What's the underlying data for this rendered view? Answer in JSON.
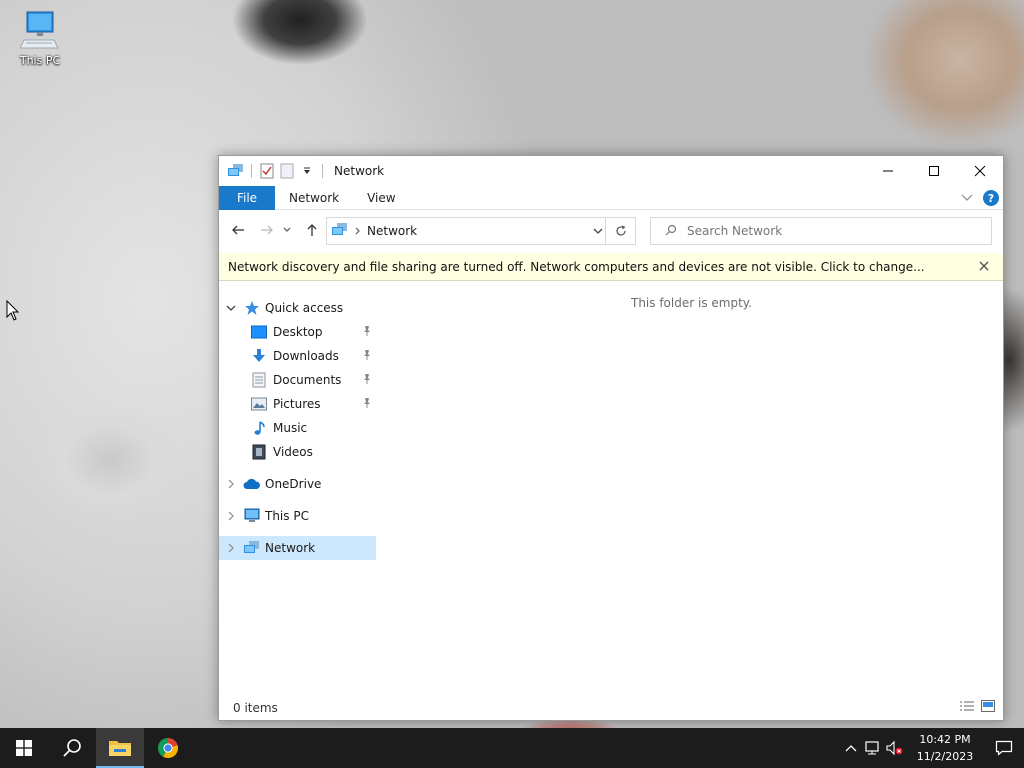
{
  "desktop": {
    "icons": [
      {
        "label": "This PC",
        "icon": "this-pc-icon"
      }
    ]
  },
  "window": {
    "title": "Network",
    "controls": {
      "minimize": "minimize-icon",
      "maximize": "maximize-icon",
      "close": "close-icon"
    }
  },
  "ribbon": {
    "tabs": [
      "File",
      "Network",
      "View"
    ],
    "help": "?"
  },
  "address": {
    "crumbs": [
      "Network"
    ],
    "search_placeholder": "Search Network"
  },
  "infobar": {
    "message": "Network discovery and file sharing are turned off. Network computers and devices are not visible. Click to change..."
  },
  "nav": {
    "quick_access": "Quick access",
    "quick_items": [
      {
        "label": "Desktop",
        "icon": "desktop-folder-icon",
        "pinned": true
      },
      {
        "label": "Downloads",
        "icon": "downloads-folder-icon",
        "pinned": true
      },
      {
        "label": "Documents",
        "icon": "documents-folder-icon",
        "pinned": true
      },
      {
        "label": "Pictures",
        "icon": "pictures-folder-icon",
        "pinned": true
      },
      {
        "label": "Music",
        "icon": "music-folder-icon",
        "pinned": false
      },
      {
        "label": "Videos",
        "icon": "videos-folder-icon",
        "pinned": false
      }
    ],
    "onedrive": "OneDrive",
    "this_pc": "This PC",
    "network": "Network"
  },
  "content": {
    "empty_message": "This folder is empty."
  },
  "status": {
    "items": "0 items"
  },
  "taskbar": {
    "apps": [
      "start-icon",
      "search-icon",
      "file-explorer-icon",
      "chrome-icon"
    ],
    "time": "10:42 PM",
    "date": "11/2/2023"
  },
  "colors": {
    "accent": "#1979ca",
    "selection": "#cce8ff",
    "infobar": "#ffffe1",
    "taskbar": "#1c1c1c"
  }
}
